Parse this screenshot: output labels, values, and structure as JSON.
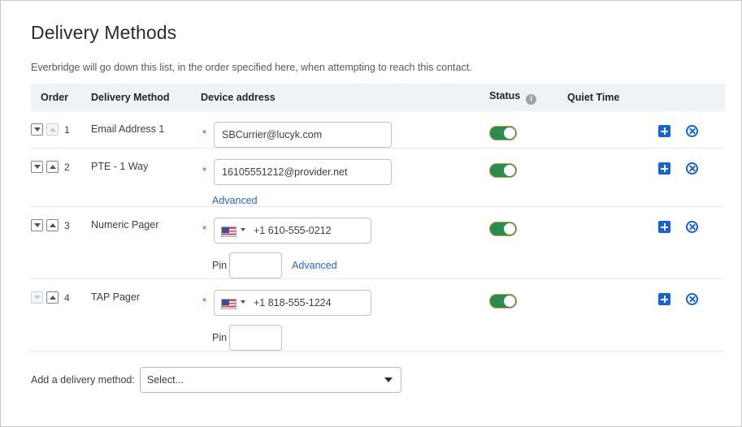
{
  "header": {
    "title": "Delivery Methods",
    "subtitle": "Everbridge will go down this list, in the order specified here, when attempting to reach this contact."
  },
  "table": {
    "columns": {
      "order": "Order",
      "method": "Delivery Method",
      "device": "Device address",
      "status": "Status",
      "quiet": "Quiet Time"
    },
    "status_info_glyph": "i",
    "required_marker": "*",
    "rows": [
      {
        "order": "1",
        "method": "Email Address 1",
        "device_type": "email",
        "value": "SBCurrier@lucyk.com",
        "down_enabled": true,
        "up_enabled": false,
        "status_on": true,
        "quiet_time": "",
        "advanced_label": "",
        "pin_label": "",
        "pin_value": ""
      },
      {
        "order": "2",
        "method": "PTE - 1 Way",
        "device_type": "email",
        "value": "16105551212@provider.net",
        "down_enabled": true,
        "up_enabled": true,
        "status_on": true,
        "quiet_time": "",
        "advanced_label": "Advanced",
        "pin_label": "",
        "pin_value": ""
      },
      {
        "order": "3",
        "method": "Numeric Pager",
        "device_type": "phone",
        "value": "+1 610-555-0212",
        "country": "United States",
        "down_enabled": true,
        "up_enabled": true,
        "status_on": true,
        "quiet_time": "",
        "advanced_label": "Advanced",
        "pin_label": "Pin",
        "pin_value": ""
      },
      {
        "order": "4",
        "method": "TAP Pager",
        "device_type": "phone",
        "value": "+1 818-555-1224",
        "country": "United States",
        "down_enabled": false,
        "up_enabled": true,
        "status_on": true,
        "quiet_time": "",
        "advanced_label": "",
        "pin_label": "Pin",
        "pin_value": ""
      }
    ]
  },
  "footer": {
    "label": "Add a delivery method:",
    "select_value": "Select...",
    "select_options": [
      "Select..."
    ]
  },
  "colors": {
    "toggle_on": "#2b8a4e",
    "action_blue": "#1663d6",
    "link_blue": "#2a63c4",
    "header_bg": "#eff3f6",
    "required_red": "#c0392b"
  }
}
